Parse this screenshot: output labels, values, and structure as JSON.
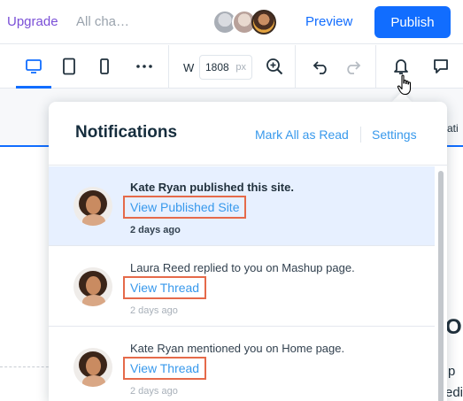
{
  "topbar": {
    "upgrade_label": "Upgrade",
    "all_changes_label": "All cha…",
    "preview_label": "Preview",
    "publish_label": "Publish"
  },
  "toolbar": {
    "width_label": "W",
    "width_value": "1808",
    "width_unit": "px",
    "icons": [
      "desktop-icon",
      "tablet-icon",
      "mobile-icon",
      "more-icon",
      "zoom-icon",
      "undo-icon",
      "redo-icon",
      "notifications-icon",
      "comments-icon"
    ]
  },
  "canvas_peek": {
    "top_right": "ati",
    "heading_fragment": "O",
    "line1": "p",
    "line2": "edi",
    "line3": "s"
  },
  "notifications": {
    "title": "Notifications",
    "mark_all_label": "Mark All as Read",
    "settings_label": "Settings",
    "items": [
      {
        "message": "Kate Ryan published this site.",
        "link": "View Published Site",
        "time": "2 days ago",
        "unread": true
      },
      {
        "message": "Laura Reed replied to you on Mashup page.",
        "link": "View Thread",
        "time": "2 days ago",
        "unread": false
      },
      {
        "message": "Kate Ryan mentioned you on Home page.",
        "link": "View Thread",
        "time": "2 days ago",
        "unread": false
      }
    ]
  },
  "colors": {
    "accent": "#116dff",
    "link": "#3899ec",
    "upgrade": "#7a4fd7",
    "unread_bg": "#e7f0ff",
    "highlight_box": "#e56a4a"
  }
}
